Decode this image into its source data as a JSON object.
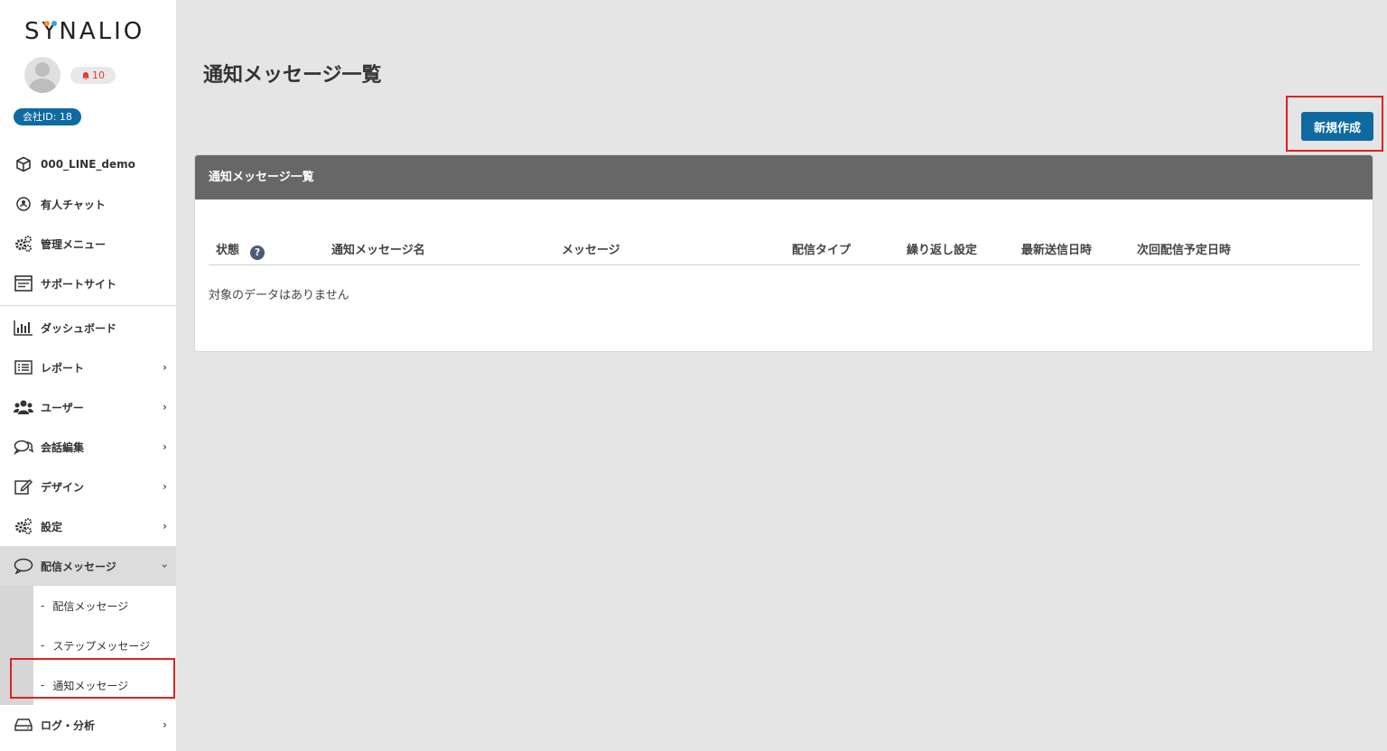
{
  "brand": {
    "logo": "SYNALIO"
  },
  "user": {
    "notifications": "10",
    "company_id": "会社ID: 18"
  },
  "sidebar": {
    "items": [
      {
        "label": "000_LINE_demo",
        "icon": "cube-icon"
      },
      {
        "label": "有人チャット",
        "icon": "headset-icon"
      },
      {
        "label": "管理メニュー",
        "icon": "gears-icon"
      },
      {
        "label": "サポートサイト",
        "icon": "browser-icon"
      },
      {
        "label": "ダッシュボード",
        "icon": "bar-chart-icon"
      },
      {
        "label": "レポート",
        "icon": "list-icon"
      },
      {
        "label": "ユーザー",
        "icon": "users-icon"
      },
      {
        "label": "会話編集",
        "icon": "chat-bubbles-icon"
      },
      {
        "label": "デザイン",
        "icon": "edit-icon"
      },
      {
        "label": "設定",
        "icon": "gears-icon"
      },
      {
        "label": "配信メッセージ",
        "icon": "speech-bubble-icon"
      },
      {
        "label": "ログ・分析",
        "icon": "drive-icon"
      }
    ],
    "sub_items": [
      {
        "label": "配信メッセージ"
      },
      {
        "label": "ステップメッセージ"
      },
      {
        "label": "通知メッセージ"
      }
    ],
    "dash": "-"
  },
  "main": {
    "title": "通知メッセージ一覧",
    "create_button": "新規作成",
    "panel_title": "通知メッセージ一覧",
    "columns": [
      "状態",
      "通知メッセージ名",
      "メッセージ",
      "配信タイプ",
      "繰り返し設定",
      "最新送信日時",
      "次回配信予定日時"
    ],
    "help_symbol": "?",
    "empty_message": "対象のデータはありません"
  },
  "colors": {
    "accent": "#0e6aa0",
    "panel_header": "#676767",
    "highlight": "#e02020"
  }
}
